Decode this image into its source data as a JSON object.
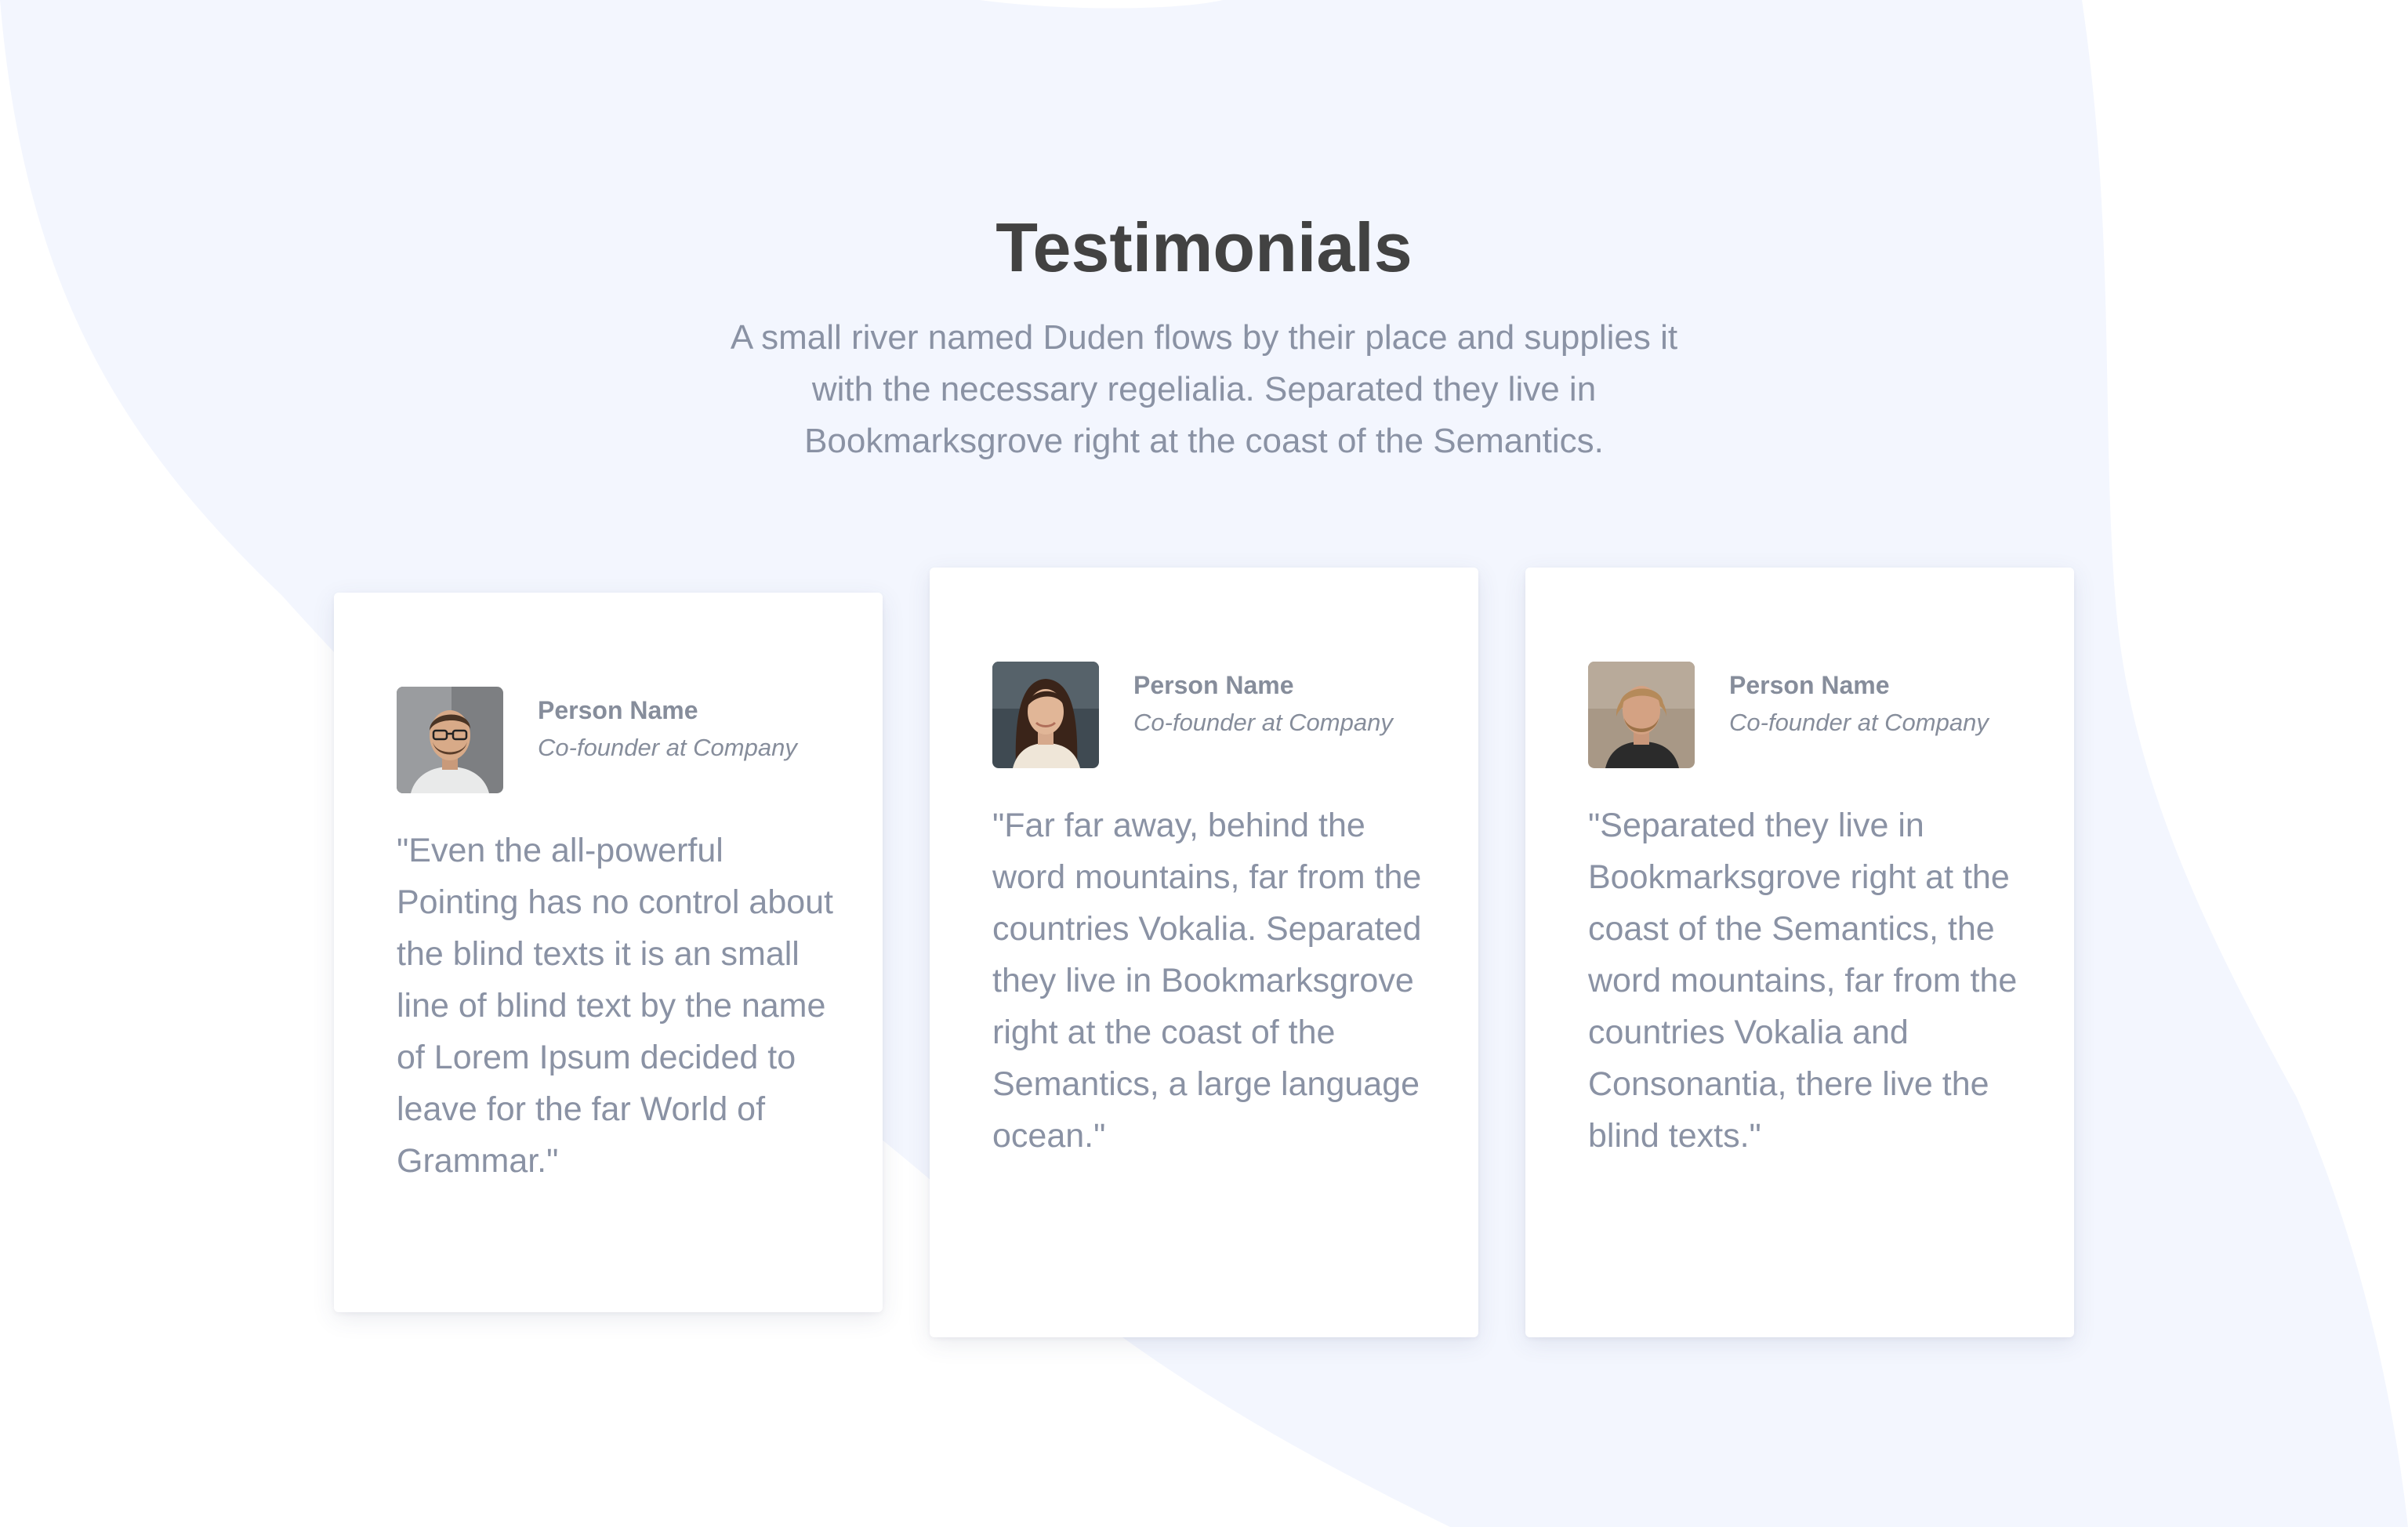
{
  "section": {
    "title": "Testimonials",
    "intro": "A small river named Duden flows by their place and supplies it with the necessary regelialia. Separated they live in Bookmarksgrove right at the coast of the Semantics."
  },
  "testimonials": [
    {
      "name": "Person Name",
      "role": "Co-founder at Company",
      "quote": "\"Even the all-powerful Pointing has no control about the blind texts it is an small line of blind text by the name of Lorem Ipsum decided to leave for the far World of Grammar.\""
    },
    {
      "name": "Person Name",
      "role": "Co-founder at Company",
      "quote": "\"Far far away, behind the word mountains, far from the countries Vokalia. Separated they live in Bookmarksgrove right at the coast of the Semantics, a large language ocean.\""
    },
    {
      "name": "Person Name",
      "role": "Co-founder at Company",
      "quote": "\"Separated they live in Bookmarksgrove right at the coast of the Semantics, the word mountains, far from the countries Vokalia and Consonantia, there live the blind texts.\""
    }
  ],
  "colors": {
    "background_blob": "#f3f6fe",
    "heading": "#424242",
    "body_text": "#8a92a4",
    "card_background": "#ffffff"
  }
}
